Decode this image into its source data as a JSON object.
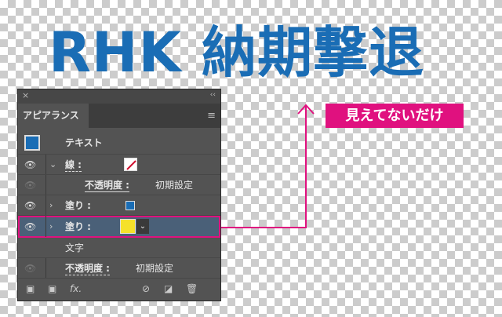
{
  "headline": "RHK 納期撃退",
  "callout": "見えてないだけ",
  "colors": {
    "headline": "#1a6db5",
    "accent": "#e0117f",
    "fill_blue": "#1a6db5",
    "fill_yellow": "#f5e12a",
    "selected_row": "#4a6078"
  },
  "panel": {
    "close": "×",
    "collapse": "‹‹",
    "tab": "アピアランス",
    "menu": "≡",
    "object": "テキスト",
    "stroke_label": "線 :",
    "opacity_label": "不透明度 :",
    "opacity_value": "初期設定",
    "fill1_label": "塗り :",
    "fill2_label": "塗り :",
    "characters": "文字",
    "opacity2_label": "不透明度 :",
    "opacity2_value": "初期設定"
  },
  "footer": {
    "fx": "fx."
  }
}
